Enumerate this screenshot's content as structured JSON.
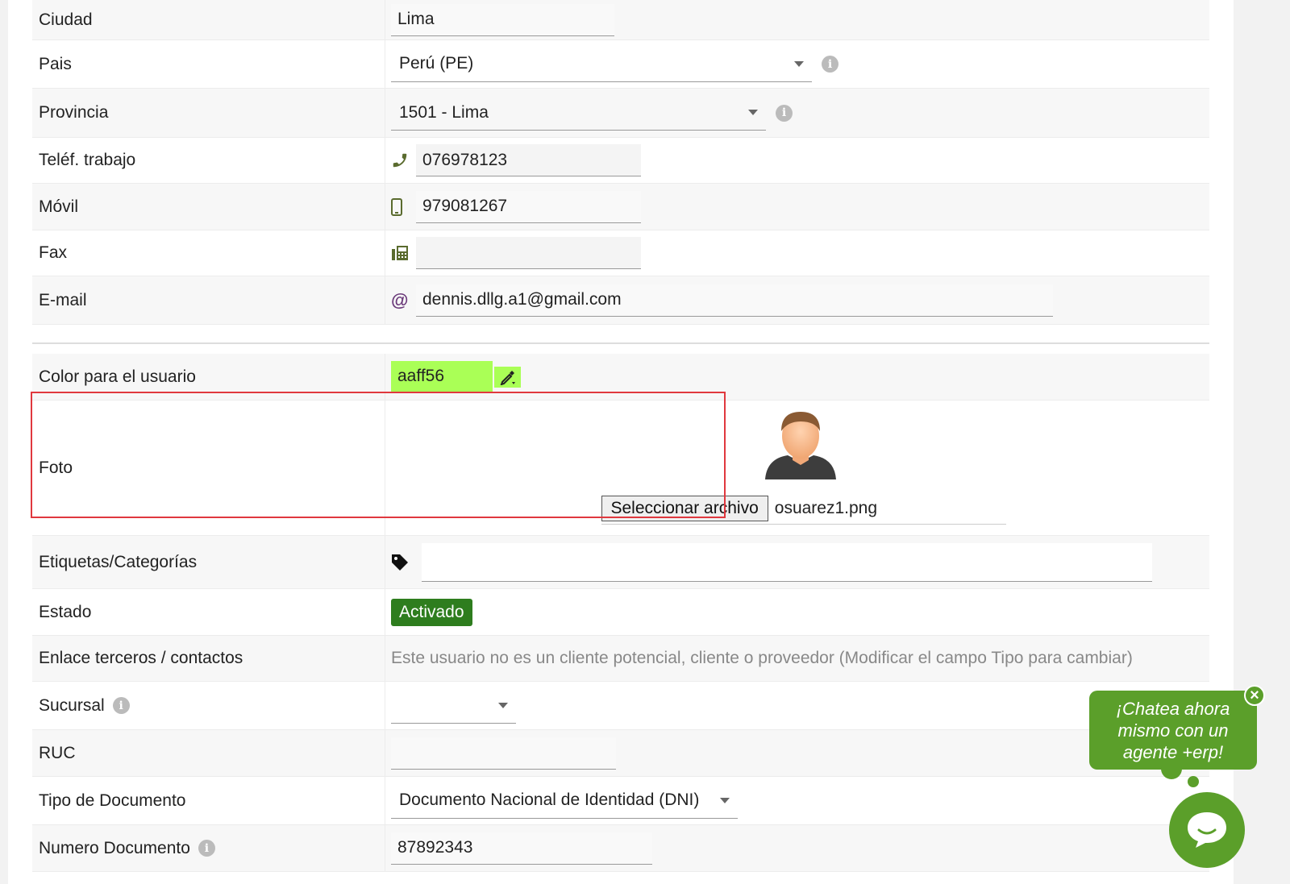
{
  "fields": {
    "ciudad": {
      "label": "Ciudad",
      "value": "Lima"
    },
    "pais": {
      "label": "Pais",
      "value": "Perú (PE)"
    },
    "provincia": {
      "label": "Provincia",
      "value": "1501 - Lima"
    },
    "tel_trabajo": {
      "label": "Teléf. trabajo",
      "value": "076978123"
    },
    "movil": {
      "label": "Móvil",
      "value": "979081267"
    },
    "fax": {
      "label": "Fax",
      "value": ""
    },
    "email": {
      "label": "E-mail",
      "value": "dennis.dllg.a1@gmail.com"
    },
    "color": {
      "label": "Color para el usuario",
      "value": "aaff56"
    },
    "foto": {
      "label": "Foto",
      "button": "Seleccionar archivo",
      "file": "osuarez1.png"
    },
    "etiquetas": {
      "label": "Etiquetas/Categorías",
      "placeholder": ""
    },
    "estado": {
      "label": "Estado",
      "value": "Activado"
    },
    "enlace": {
      "label": "Enlace terceros / contactos",
      "value": "Este usuario no es un cliente potencial, cliente o proveedor (Modificar el campo Tipo para cambiar)"
    },
    "sucursal": {
      "label": "Sucursal",
      "value": ""
    },
    "ruc": {
      "label": "RUC",
      "value": ""
    },
    "tipo_doc": {
      "label": "Tipo de Documento",
      "value": "Documento Nacional de Identidad (DNI)"
    },
    "num_doc": {
      "label": "Numero Documento",
      "value": "87892343"
    }
  },
  "chat": {
    "bubble": "¡Chatea ahora mismo con un agente +erp!",
    "close": "×"
  },
  "colors": {
    "user_color": "#aaff56",
    "badge": "#2e7d1e",
    "chat": "#5b9f2a",
    "highlight": "#e0383e"
  }
}
